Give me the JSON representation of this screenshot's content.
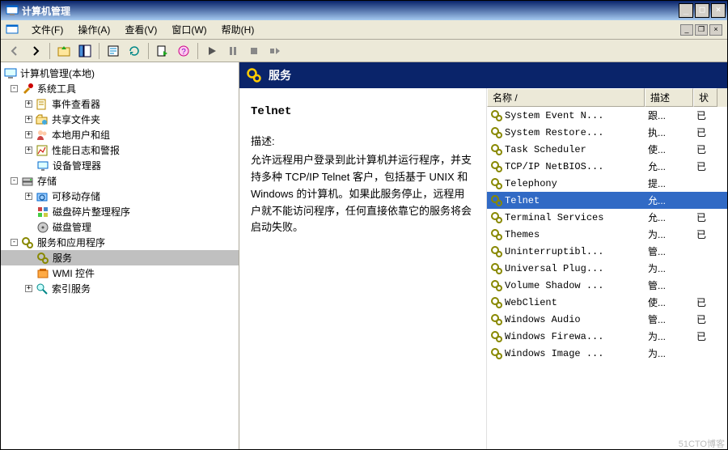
{
  "window": {
    "title": "计算机管理",
    "min": "_",
    "max": "□",
    "close": "×"
  },
  "mdi": {
    "min": "_",
    "restore": "❐",
    "close": "×"
  },
  "menus": {
    "file": "文件(F)",
    "action": "操作(A)",
    "view": "查看(V)",
    "window": "窗口(W)",
    "help": "帮助(H)"
  },
  "tree": {
    "root": "计算机管理(本地)",
    "system_tools": "系统工具",
    "event_viewer": "事件查看器",
    "shared_folders": "共享文件夹",
    "local_users": "本地用户和组",
    "perf_logs": "性能日志和警报",
    "device_mgr": "设备管理器",
    "storage": "存储",
    "removable": "可移动存储",
    "defrag": "磁盘碎片整理程序",
    "disk_mgmt": "磁盘管理",
    "services_apps": "服务和应用程序",
    "services": "服务",
    "wmi": "WMI 控件",
    "indexing": "索引服务"
  },
  "right_header": {
    "title": "服务"
  },
  "desc": {
    "title": "Telnet",
    "label": "描述:",
    "text": "允许远程用户登录到此计算机并运行程序，并支持多种 TCP/IP Telnet 客户，包括基于 UNIX 和 Windows 的计算机。如果此服务停止，远程用户就不能访问程序，任何直接依靠它的服务将会启动失败。"
  },
  "columns": {
    "name": "名称  /",
    "desc": "描述",
    "status": "状"
  },
  "services": [
    {
      "name": "System Event N...",
      "desc": "跟...",
      "stat": "已",
      "sel": false
    },
    {
      "name": "System Restore...",
      "desc": "执...",
      "stat": "已",
      "sel": false
    },
    {
      "name": "Task Scheduler",
      "desc": "使...",
      "stat": "已",
      "sel": false
    },
    {
      "name": "TCP/IP NetBIOS...",
      "desc": "允...",
      "stat": "已",
      "sel": false
    },
    {
      "name": "Telephony",
      "desc": "提...",
      "stat": "",
      "sel": false
    },
    {
      "name": "Telnet",
      "desc": "允...",
      "stat": "",
      "sel": true
    },
    {
      "name": "Terminal Services",
      "desc": "允...",
      "stat": "已",
      "sel": false
    },
    {
      "name": "Themes",
      "desc": "为...",
      "stat": "已",
      "sel": false
    },
    {
      "name": "Uninterruptibl...",
      "desc": "管...",
      "stat": "",
      "sel": false
    },
    {
      "name": "Universal Plug...",
      "desc": "为...",
      "stat": "",
      "sel": false
    },
    {
      "name": "Volume Shadow ...",
      "desc": "管...",
      "stat": "",
      "sel": false
    },
    {
      "name": "WebClient",
      "desc": "使...",
      "stat": "已",
      "sel": false
    },
    {
      "name": "Windows Audio",
      "desc": "管...",
      "stat": "已",
      "sel": false
    },
    {
      "name": "Windows Firewa...",
      "desc": "为...",
      "stat": "已",
      "sel": false
    },
    {
      "name": "Windows Image ...",
      "desc": "为...",
      "stat": "",
      "sel": false
    }
  ],
  "watermark": "51CTO博客"
}
